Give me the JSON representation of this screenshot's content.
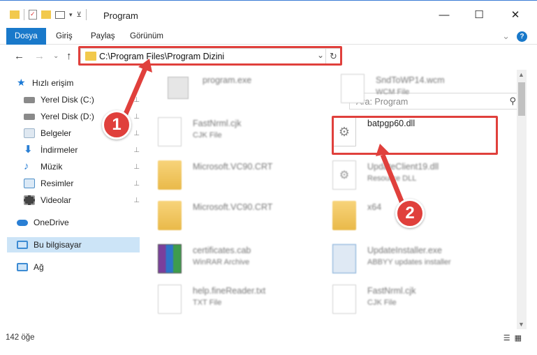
{
  "window": {
    "title": "Program",
    "minimize": "—",
    "maximize": "☐",
    "close": "✕"
  },
  "ribbon": {
    "tabs": [
      "Dosya",
      "Giriş",
      "Paylaş",
      "Görünüm"
    ],
    "expand": "⌄",
    "help": "?"
  },
  "nav": {
    "back": "←",
    "forward": "→",
    "recent": "⌄",
    "up": "↑",
    "address": "C:\\Program Files\\Program Dizini",
    "address_dropdown": "⌄",
    "refresh": "↻",
    "search_placeholder": "Ara: Program",
    "search_icon": "⚲"
  },
  "sidebar": {
    "pin": "📌",
    "items": [
      {
        "label": "Hızlı erişim",
        "icon": "star-icon",
        "color": "#1b7ad6"
      },
      {
        "label": "Yerel Disk (C:)",
        "icon": "drive-icon",
        "color": "#8a8a8a"
      },
      {
        "label": "Yerel Disk (D:)",
        "icon": "drive-icon",
        "color": "#8a8a8a"
      },
      {
        "label": "Belgeler",
        "icon": "documents-icon",
        "color": "#9bb3c9"
      },
      {
        "label": "İndirmeler",
        "icon": "download-icon",
        "color": "#2a7fd4"
      },
      {
        "label": "Müzik",
        "icon": "music-icon",
        "color": "#2a7fd4"
      },
      {
        "label": "Resimler",
        "icon": "pictures-icon",
        "color": "#4d8fc8"
      },
      {
        "label": "Videolar",
        "icon": "video-icon",
        "color": "#444444"
      },
      {
        "label": "OneDrive",
        "icon": "cloud-icon",
        "color": "#2a7fd4"
      },
      {
        "label": "Bu bilgisayar",
        "icon": "computer-icon",
        "color": "#3c8bd3"
      },
      {
        "label": "Ağ",
        "icon": "network-icon",
        "color": "#3c8bd3"
      }
    ]
  },
  "files": [
    {
      "name": "program.exe",
      "type": "",
      "icon": "exe-icon"
    },
    {
      "name": "SndToWP14.wcm",
      "type": "WCM File",
      "icon": "file-icon"
    },
    {
      "name": "FastNrml.cjk",
      "type": "CJK File",
      "icon": "file-icon"
    },
    {
      "name": "batpgp60.dll",
      "type": "",
      "icon": "dll-icon"
    },
    {
      "name": "Microsoft.VC90.CRT",
      "type": "",
      "icon": "folder-icon"
    },
    {
      "name": "UpdateClient19.dll",
      "type": "Resource DLL",
      "icon": "dll-icon"
    },
    {
      "name": "Microsoft.VC90.CRT",
      "type": "",
      "icon": "folder-icon"
    },
    {
      "name": "x64",
      "type": "",
      "icon": "folder-icon"
    },
    {
      "name": "certificates.cab",
      "type": "WinRAR Archive",
      "icon": "archive-icon"
    },
    {
      "name": "UpdateInstaller.exe",
      "type": "ABBYY updates installer",
      "icon": "installer-icon"
    },
    {
      "name": "help.fineReader.txt",
      "type": "TXT File",
      "icon": "file-icon"
    },
    {
      "name": "FastNrml.cjk",
      "type": "CJK File",
      "icon": "file-icon"
    }
  ],
  "status": {
    "count": "142 öğe",
    "details_view": "☰",
    "icons_view": "▦"
  },
  "callouts": [
    "1",
    "2"
  ],
  "colors": {
    "accent": "#1979ca",
    "highlight": "#e0403c",
    "selected": "#cce4f7"
  }
}
